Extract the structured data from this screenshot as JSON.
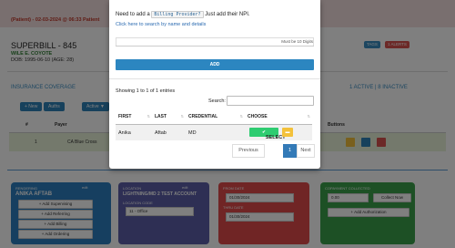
{
  "background": {
    "alert_text": "(Patient) - 02-03-2024 @ 06:33 Patient",
    "title": "SUPERBILL - 845",
    "patient_name": "WILE E. COYOTE",
    "dob": "DOB: 1995-06-10 (AGE: 28)",
    "tags_button": "TAGS",
    "alerts_button": "1 ALERTS",
    "insurance_title": "INSURANCE COVERAGE",
    "insurance_status": "1 ACTIVE | 8 INACTIVE",
    "btn_new": "+ New",
    "btn_auths": "Auths",
    "btn_active": "Active ▼",
    "table_headers": [
      "#",
      "Payer",
      "Buttons"
    ],
    "row_index": "1",
    "row_payer": "CA Blue Cross",
    "cards": [
      {
        "header": "RENDERING",
        "value": "ANIKA AFTAB",
        "edit": "edit",
        "buttons": [
          "+ Add Supervising",
          "+ Add Referring",
          "+ Add Billing",
          "+ Add Ordering"
        ]
      },
      {
        "header": "LOCATION",
        "value": "LIGHTNING/MD 2 TEST ACCOUNT",
        "edit": "edit",
        "sub_label": "LOCATION CODE",
        "select": "11 - Office"
      },
      {
        "header": "FROM DATE",
        "from_value": "01/30/2024",
        "thru_label": "THRU DATE",
        "thru_value": "01/30/2024"
      },
      {
        "header": "COPAYMENT COLLECTED",
        "copay_value": "0.00",
        "collect_button": "Collect Now",
        "auth_button": "+ Add Authorization"
      }
    ],
    "colors": {
      "alert_bg": "#f2dede",
      "blue": "#2f82b8",
      "card1": "#2d7fc0",
      "card2": "#5c5fa8",
      "card3": "#e04a4a",
      "card4": "#3aa14a"
    }
  },
  "modal": {
    "intro_prefix": "Need to add a",
    "intro_code": "Billing Provider?",
    "intro_suffix": "Just add their NPI.",
    "search_link": "Click here to search by name and details",
    "hint": "Must be 10 Digits",
    "add_button": "ADD",
    "showing": "Showing 1 to 1 of 1 entries",
    "search_label": "Search:",
    "columns": [
      "FIRST",
      "LAST",
      "CREDENTIAL",
      "CHOOSE"
    ],
    "row": {
      "first": "Anika",
      "last": "Aftab",
      "credential": "MD",
      "select_button": "SELECT"
    },
    "pagination": {
      "previous": "Previous",
      "current": "1",
      "next": "Next"
    }
  }
}
